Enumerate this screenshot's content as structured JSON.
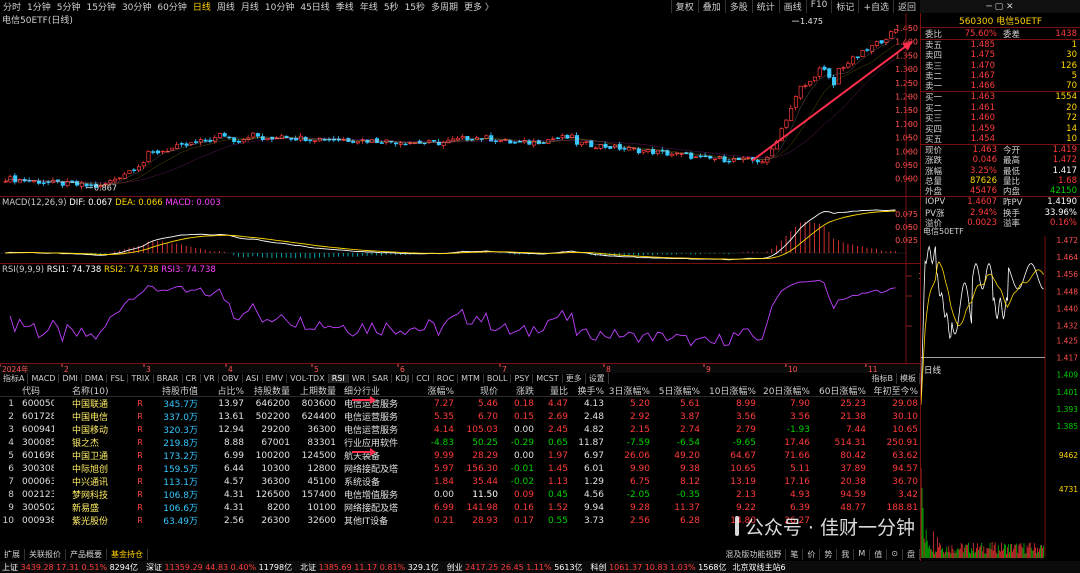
{
  "period_tabs": [
    "分时",
    "1分钟",
    "5分钟",
    "15分钟",
    "30分钟",
    "60分钟",
    "日线",
    "周线",
    "月线",
    "10分钟",
    "45日线",
    "季线",
    "年线",
    "5秒",
    "15秒",
    "多周期",
    "更多 〉"
  ],
  "active_period": "日线",
  "toolbar": [
    "复权",
    "叠加",
    "多股",
    "统计",
    "画线",
    "F10",
    "标记",
    "+自选",
    "返回"
  ],
  "chart_title": "电信50ETF(日线)",
  "price_axis": [
    "1.450",
    "1.400",
    "1.350",
    "1.300",
    "1.250",
    "1.200",
    "1.150",
    "1.100",
    "1.050",
    "1.000",
    "0.950",
    "0.900"
  ],
  "high_label": "1.475",
  "low_label": "0.867",
  "macd": {
    "title": "MACD(12,26,9)",
    "dif": "DIF: 0.067",
    "dea": "DEA: 0.066",
    "macd": "MACD: 0.003",
    "axis": [
      "0.075",
      "0.050",
      "0.025"
    ]
  },
  "rsi": {
    "title": "RSI(9,9,9)",
    "r1": "RSI1: 74.738",
    "r2": "RSI2: 74.738",
    "r3": "RSI3: 74.738",
    "axis": [
      "100.00",
      "80.00",
      "50.00"
    ]
  },
  "months": [
    "2024年",
    "2",
    "3",
    "4",
    "5",
    "6",
    "7",
    "8",
    "9",
    "10",
    "11"
  ],
  "indicator_tabs": [
    "指标A",
    "MACD",
    "DMI",
    "DMA",
    "FSL",
    "TRIX",
    "BRAR",
    "CR",
    "VR",
    "OBV",
    "ASI",
    "EMV",
    "VOL-TDX",
    "RSI",
    "WR",
    "SAR",
    "KDJ",
    "CCI",
    "ROC",
    "MTM",
    "BOLL",
    "PSY",
    "MCST",
    "更多",
    "设置"
  ],
  "indicator_right": [
    "指标B",
    "模板"
  ],
  "table": {
    "headers": [
      "",
      "代码",
      "名称(10)",
      "",
      "持股市值",
      "占比%",
      "持股数量",
      "上期数量",
      "细分行业",
      "涨幅%",
      "现价",
      "涨跌",
      "量比",
      "换手%",
      "3日涨幅%",
      "5日涨幅%",
      "10日涨幅%",
      "20日涨幅%",
      "60日涨幅%",
      "年初至今%"
    ],
    "rows": [
      {
        "i": "1",
        "code": "600050",
        "name": "中国联通",
        "r": "R",
        "mkt": "345.7万",
        "pct": "13.97",
        "hold": "646200",
        "prev": "803600",
        "ind": "电信运营服务",
        "chg": "7.27",
        "px": "5.46",
        "spd": "0.18",
        "vr": "4.47",
        "turn": "4.13",
        "d3": "5.20",
        "d5": "5.61",
        "d10": "8.99",
        "d20": "7.90",
        "d60": "25.23",
        "y": "29.08",
        "up": true
      },
      {
        "i": "2",
        "code": "601728",
        "name": "中国电信",
        "r": "R",
        "mkt": "337.0万",
        "pct": "13.61",
        "hold": "502200",
        "prev": "624400",
        "ind": "电信运营服务",
        "chg": "5.35",
        "px": "6.70",
        "spd": "0.15",
        "vr": "2.69",
        "turn": "2.48",
        "d3": "2.92",
        "d5": "3.87",
        "d10": "3.56",
        "d20": "3.56",
        "d60": "21.38",
        "y": "30.10",
        "up": true
      },
      {
        "i": "3",
        "code": "600941",
        "name": "中国移动",
        "r": "R",
        "mkt": "320.3万",
        "pct": "12.94",
        "hold": "29200",
        "prev": "36300",
        "ind": "电信运营服务",
        "chg": "4.14",
        "px": "105.03",
        "spd": "0.00",
        "vr": "2.45",
        "turn": "4.82",
        "d3": "2.15",
        "d5": "2.74",
        "d10": "2.79",
        "d20": "-1.93",
        "d60": "7.44",
        "y": "10.65",
        "up": true
      },
      {
        "i": "4",
        "code": "300085",
        "name": "银之杰",
        "r": "R",
        "mkt": "219.8万",
        "pct": "8.88",
        "hold": "67001",
        "prev": "83301",
        "ind": "行业应用软件",
        "chg": "-4.83",
        "px": "50.25",
        "spd": "-0.29",
        "vr": "0.65",
        "turn": "11.87",
        "d3": "-7.59",
        "d5": "-6.54",
        "d10": "-9.65",
        "d20": "17.46",
        "d60": "514.31",
        "y": "250.91",
        "up": false
      },
      {
        "i": "5",
        "code": "601698",
        "name": "中国卫通",
        "r": "R",
        "mkt": "173.2万",
        "pct": "6.99",
        "hold": "100200",
        "prev": "124500",
        "ind": "航天装备",
        "chg": "9.99",
        "px": "28.29",
        "spd": "0.00",
        "vr": "1.97",
        "turn": "6.97",
        "d3": "26.06",
        "d5": "49.20",
        "d10": "64.67",
        "d20": "71.66",
        "d60": "80.42",
        "y": "63.62",
        "up": true
      },
      {
        "i": "6",
        "code": "300308",
        "name": "中际旭创",
        "r": "R",
        "mkt": "159.5万",
        "pct": "6.44",
        "hold": "10300",
        "prev": "12800",
        "ind": "网络接配及塔",
        "chg": "5.97",
        "px": "156.30",
        "spd": "-0.01",
        "vr": "1.45",
        "turn": "6.01",
        "d3": "9.90",
        "d5": "9.38",
        "d10": "10.65",
        "d20": "5.11",
        "d60": "37.89",
        "y": "94.57",
        "up": true
      },
      {
        "i": "7",
        "code": "000063",
        "name": "中兴通讯",
        "r": "R",
        "mkt": "113.1万",
        "pct": "4.57",
        "hold": "36300",
        "prev": "45100",
        "ind": "系统设备",
        "chg": "1.84",
        "px": "35.44",
        "spd": "-0.02",
        "vr": "1.13",
        "turn": "1.29",
        "d3": "6.75",
        "d5": "8.12",
        "d10": "13.19",
        "d20": "17.16",
        "d60": "20.38",
        "y": "36.70",
        "up": true
      },
      {
        "i": "8",
        "code": "002123",
        "name": "梦网科技",
        "r": "R",
        "mkt": "106.8万",
        "pct": "4.31",
        "hold": "126500",
        "prev": "157400",
        "ind": "电信增值服务",
        "chg": "0.00",
        "px": "11.50",
        "spd": "0.09",
        "vr": "0.45",
        "turn": "4.56",
        "d3": "-2.05",
        "d5": "-0.35",
        "d10": "2.13",
        "d20": "4.93",
        "d60": "94.59",
        "y": "3.42",
        "up": null
      },
      {
        "i": "9",
        "code": "300502",
        "name": "新易盛",
        "r": "R",
        "mkt": "106.6万",
        "pct": "4.31",
        "hold": "8200",
        "prev": "10100",
        "ind": "网络接配及塔",
        "chg": "6.99",
        "px": "141.98",
        "spd": "0.16",
        "vr": "1.52",
        "turn": "9.94",
        "d3": "9.28",
        "d5": "11.37",
        "d10": "9.22",
        "d20": "6.39",
        "d60": "48.77",
        "y": "188.81",
        "up": true
      },
      {
        "i": "10",
        "code": "000938",
        "name": "紫光股份",
        "r": "R",
        "mkt": "63.49万",
        "pct": "2.56",
        "hold": "26300",
        "prev": "32600",
        "ind": "其他IT设备",
        "chg": "0.21",
        "px": "28.93",
        "spd": "0.17",
        "vr": "0.55",
        "turn": "3.73",
        "d3": "2.56",
        "d5": "6.28",
        "d10": "14.80",
        "d20": "26.27",
        "d60": "",
        "y": "",
        "up": true
      }
    ]
  },
  "bottom_tabs": [
    "扩展",
    "关联报价",
    "产品概要",
    "基金持仓"
  ],
  "bottom_active": "基金持仓",
  "bottom_right": [
    "混及版功能视野",
    "笔",
    "价",
    "势",
    "我",
    "M",
    "值",
    "⊙",
    "盘"
  ],
  "statusbar": [
    {
      "n": "上证",
      "v": "3439.28",
      "c": "17.31",
      "p": "0.51%",
      "a": "8294亿"
    },
    {
      "n": "深证",
      "v": "11359.29",
      "c": "44.83",
      "p": "0.40%",
      "a": "11798亿"
    },
    {
      "n": "北证",
      "v": "1385.69",
      "c": "11.17",
      "p": "0.81%",
      "a": "329.1亿"
    },
    {
      "n": "创业",
      "v": "2417.25",
      "c": "26.45",
      "p": "1.11%",
      "a": "5613亿"
    },
    {
      "n": "科创",
      "v": "1061.37",
      "c": "10.83",
      "p": "1.03%",
      "a": "1568亿"
    }
  ],
  "status_right": "北京双线主站6",
  "right_panel": {
    "title": "560300 电信50ETF",
    "ratio": {
      "k1": "委比",
      "v1": "75.60%",
      "k2": "委差",
      "v2": "1438"
    },
    "asks": [
      {
        "l": "卖五",
        "p": "1.485",
        "v": "1"
      },
      {
        "l": "卖四",
        "p": "1.475",
        "v": "30"
      },
      {
        "l": "卖三",
        "p": "1.470",
        "v": "126"
      },
      {
        "l": "卖二",
        "p": "1.467",
        "v": "5"
      },
      {
        "l": "卖一",
        "p": "1.466",
        "v": "70"
      }
    ],
    "bids": [
      {
        "l": "买一",
        "p": "1.463",
        "v": "1554"
      },
      {
        "l": "买二",
        "p": "1.461",
        "v": "20"
      },
      {
        "l": "买三",
        "p": "1.460",
        "v": "72"
      },
      {
        "l": "买四",
        "p": "1.459",
        "v": "14"
      },
      {
        "l": "买五",
        "p": "1.454",
        "v": "10"
      }
    ],
    "stats": [
      {
        "k1": "现价",
        "v1": "1.463",
        "c1": "red",
        "k2": "今开",
        "v2": "1.419",
        "c2": "red"
      },
      {
        "k1": "涨跌",
        "v1": "0.046",
        "c1": "red",
        "k2": "最高",
        "v2": "1.472",
        "c2": "red"
      },
      {
        "k1": "涨幅",
        "v1": "3.25%",
        "c1": "red",
        "k2": "最低",
        "v2": "1.417",
        "c2": "white"
      },
      {
        "k1": "总量",
        "v1": "87626",
        "c1": "yellow",
        "k2": "量比",
        "v2": "1.68",
        "c2": "red"
      },
      {
        "k1": "外盘",
        "v1": "45476",
        "c1": "red",
        "k2": "内盘",
        "v2": "42150",
        "c2": "green"
      },
      {
        "k1": "IOPV",
        "v1": "1.4607",
        "c1": "red",
        "k2": "昨PV",
        "v2": "1.4190",
        "c2": "white"
      },
      {
        "k1": "PV涨",
        "v1": "2.94%",
        "c1": "red",
        "k2": "换手",
        "v2": "33.96%",
        "c2": "white"
      },
      {
        "k1": "溢价",
        "v1": "0.0023",
        "c1": "red",
        "k2": "溢率",
        "v2": "0.16%",
        "c2": "red"
      }
    ],
    "mini_title": "电信50ETF",
    "mini_axis": [
      "1.472",
      "1.464",
      "1.456",
      "1.448",
      "1.440",
      "1.432",
      "1.425",
      "1.417",
      "1.409",
      "1.401",
      "1.393",
      "1.385"
    ],
    "vol_axis": [
      "9462",
      "4731"
    ],
    "tab_label": "日线"
  },
  "watermark": "公众号 · 佳财一分钟",
  "colors": {
    "up": "#ff3b3b",
    "down": "#00d000",
    "cyan": "#34c8ff",
    "divider": "#7a1010"
  }
}
